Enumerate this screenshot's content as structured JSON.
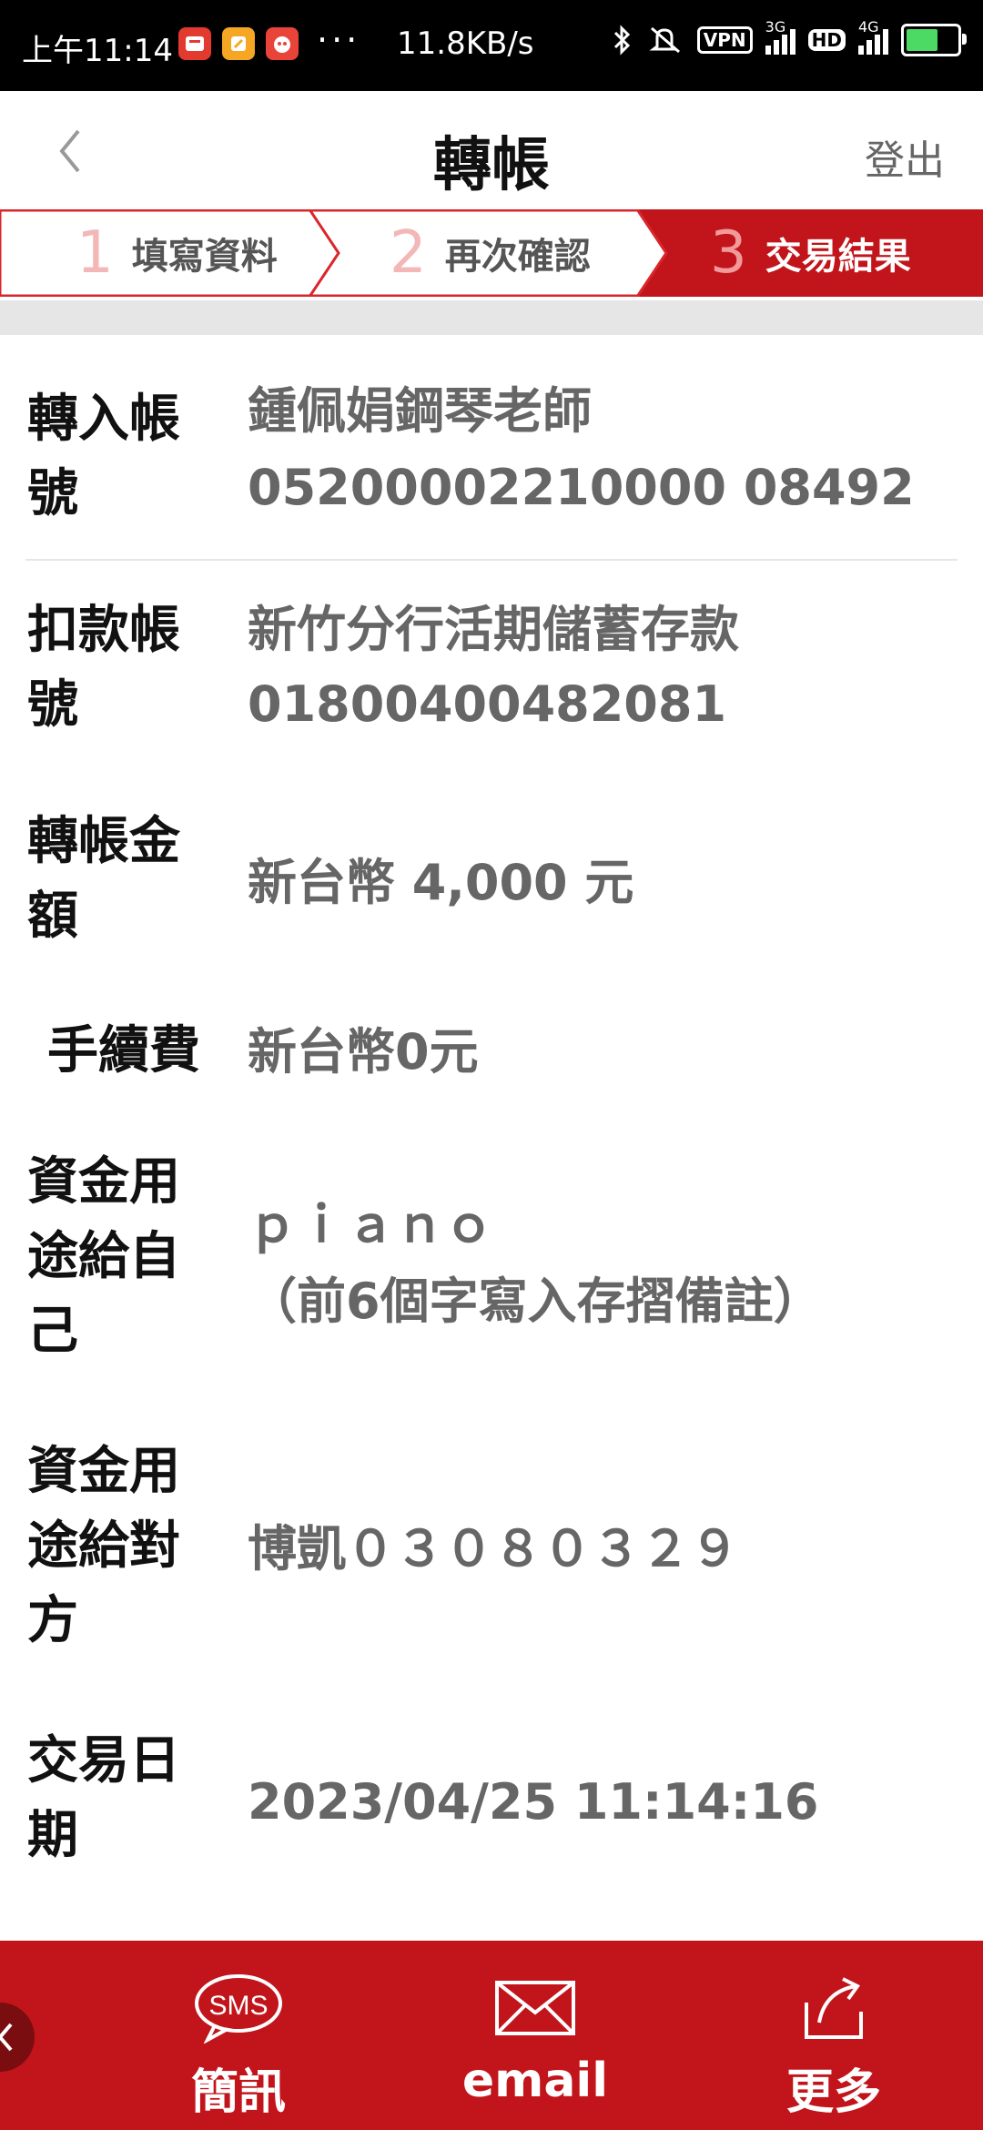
{
  "status_bar": {
    "time": "上午11:14",
    "dots": "···",
    "speed": "11.8KB/s",
    "vpn": "VPN",
    "net1": "3G",
    "hd": "HD",
    "net2": "4G"
  },
  "header": {
    "title": "轉帳",
    "logout": "登出"
  },
  "steps": [
    {
      "num": "1",
      "label": "填寫資料"
    },
    {
      "num": "2",
      "label": "再次確認"
    },
    {
      "num": "3",
      "label": "交易結果"
    }
  ],
  "rows": {
    "to_account": {
      "label": "轉入帳號",
      "value_line1": "鍾佩娟鋼琴老師",
      "value_line2": "05200002210000 08492"
    },
    "from_account": {
      "label": "扣款帳號",
      "value_line1": "新竹分行活期儲蓄存款",
      "value_line2": "01800400482081"
    },
    "amount": {
      "label": "轉帳金額",
      "value": "新台幣 4,000 元"
    },
    "fee": {
      "label": "手續費",
      "value": "新台幣0元"
    },
    "purpose_self": {
      "label": "資金用途給自己",
      "value_line1": "ｐｉａｎｏ",
      "value_line2": "（前6個字寫入存摺備註）"
    },
    "purpose_other": {
      "label": "資金用途給對方",
      "value": "博凱０３０８０３２９"
    },
    "date": {
      "label": "交易日期",
      "value": "2023/04/25 11:14:16"
    }
  },
  "bottom_bar": {
    "sms_icon_text": "SMS",
    "sms": "簡訊",
    "email": "email",
    "more": "更多"
  },
  "colors": {
    "brand_red": "#c1151b",
    "step_border": "#d9262c"
  }
}
